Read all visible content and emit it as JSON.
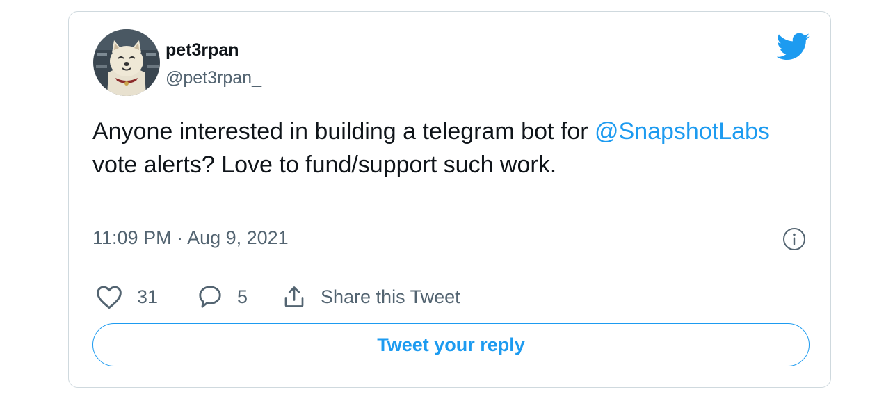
{
  "author": {
    "name": "pet3rpan",
    "handle": "@pet3rpan_",
    "avatar_icon": "cartoon-dog-avatar"
  },
  "tweet": {
    "text_before": "Anyone interested in building a telegram bot for ",
    "mention": "@SnapshotLabs",
    "text_after": " vote alerts? Love to fund/support such work.",
    "timestamp": "11:09 PM · Aug 9, 2021"
  },
  "actions": {
    "likes": "31",
    "replies": "5",
    "share_label": "Share this Tweet"
  },
  "reply_button": {
    "label": "Tweet your reply"
  },
  "colors": {
    "accent": "#1d9bf0",
    "text": "#0f1419",
    "secondary": "#536471",
    "border": "#cfd9de"
  },
  "icons": {
    "brand": "twitter-bird-icon",
    "info": "info-icon",
    "like": "heart-icon",
    "reply": "speech-bubble-icon",
    "share": "share-upload-icon"
  }
}
